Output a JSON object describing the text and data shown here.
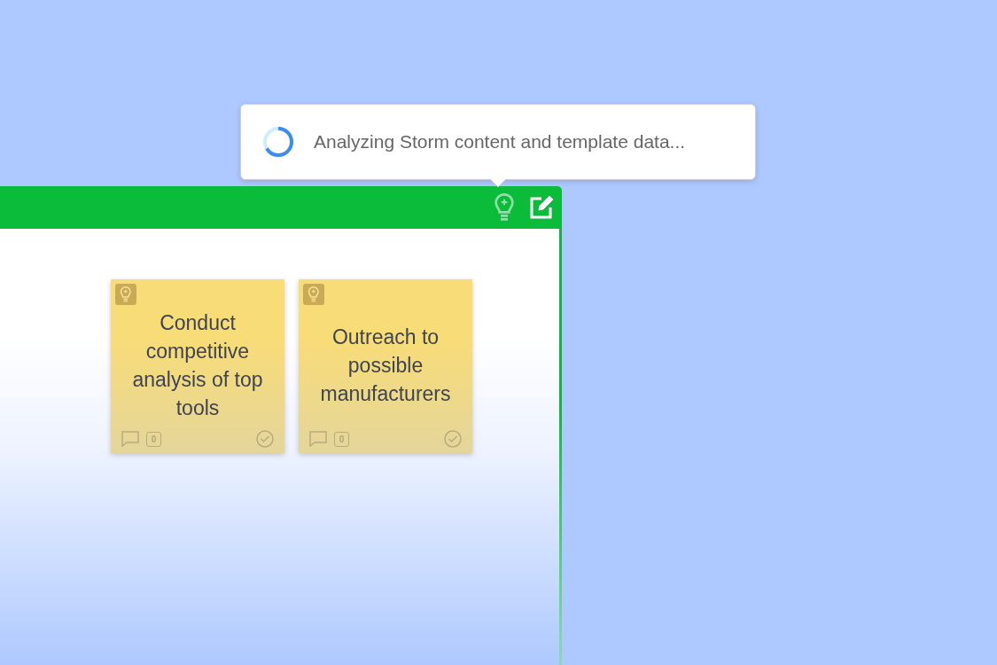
{
  "tooltip": {
    "text": "Analyzing Storm content and template data..."
  },
  "notes": [
    {
      "text": "Conduct competitive analysis of top tools",
      "comments": "0",
      "done": false
    },
    {
      "text": "Outreach to possible manufacturers",
      "comments": "0",
      "done": false
    }
  ]
}
